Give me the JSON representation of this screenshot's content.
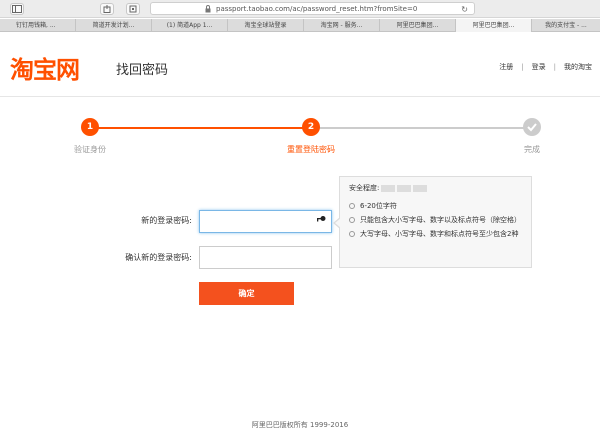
{
  "browser": {
    "url": "passport.taobao.com/ac/password_reset.htm?fromSite=0",
    "tabs": [
      {
        "label": "钉钉用钱箱, ...",
        "active": false
      },
      {
        "label": "简道开发计划...",
        "active": false
      },
      {
        "label": "(1) 简道App 1...",
        "active": false
      },
      {
        "label": "淘宝全球站登录",
        "active": false
      },
      {
        "label": "淘宝网 - 服务...",
        "active": false
      },
      {
        "label": "阿里巴巴集团...",
        "active": false
      },
      {
        "label": "阿里巴巴集团...",
        "active": true
      },
      {
        "label": "我的支付宝 - ...",
        "active": false
      }
    ]
  },
  "header": {
    "logo": "淘宝网",
    "title": "找回密码",
    "nav": [
      "注册",
      "登录",
      "我的淘宝"
    ]
  },
  "steps": [
    {
      "number": "1",
      "label": "验证身份",
      "state": "done"
    },
    {
      "number": "2",
      "label": "重置登陆密码",
      "state": "current"
    },
    {
      "number": "",
      "label": "完成",
      "state": "pending"
    }
  ],
  "form": {
    "new_password_label": "新的登录密码:",
    "confirm_password_label": "确认新的登录密码:",
    "new_password_value": "",
    "confirm_password_value": "",
    "submit_label": "确定"
  },
  "tip": {
    "strength_label": "安全程度:",
    "rules": [
      "6-20位字符",
      "只能包含大小写字母、数字以及标点符号（除空格）",
      "大写字母、小写字母、数字和标点符号至少包含2种"
    ]
  },
  "footer": {
    "copyright": "阿里巴巴版权所有 1999-2016"
  },
  "colors": {
    "accent": "#ff5000",
    "button": "#f4511e",
    "inactive": "#cccccc"
  }
}
